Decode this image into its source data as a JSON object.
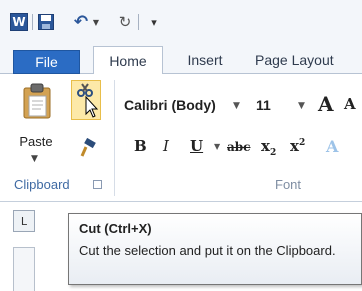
{
  "quick_access": {
    "app_logo": "W",
    "icons": [
      "word-icon",
      "save-icon",
      "undo-icon",
      "redo-icon",
      "customize-icon"
    ]
  },
  "tabs": [
    {
      "label": "File"
    },
    {
      "label": "Home"
    },
    {
      "label": "Insert"
    },
    {
      "label": "Page Layout"
    }
  ],
  "clipboard": {
    "paste_label": "Paste",
    "group_label": "Clipboard"
  },
  "font": {
    "font_name": "Calibri (Body)",
    "font_size": "11",
    "grow_label": "A",
    "shrink_label": "A",
    "bold_label": "B",
    "italic_label": "I",
    "underline_label": "U",
    "strike_label": "abc",
    "subscript_label": "x",
    "superscript_label": "x",
    "effects_label": "A",
    "group_label": "Font"
  },
  "ruler": {
    "tab_selector": "L"
  },
  "tooltip": {
    "title": "Cut (Ctrl+X)",
    "description": "Cut the selection and put it on the Clipboard."
  },
  "colors": {
    "file_tab": "#2b6cc4",
    "word_blue": "#2b579a",
    "cut_highlight": "#fde9a8",
    "group_label": "#3f6aa3"
  }
}
